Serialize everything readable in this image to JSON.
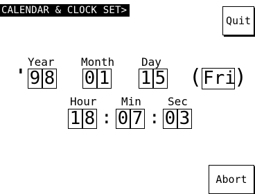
{
  "screen": {
    "title": "CALENDAR & CLOCK SET>"
  },
  "buttons": {
    "quit": "Quit",
    "abort": "Abort"
  },
  "date": {
    "labels": {
      "year": "Year",
      "month": "Month",
      "day": "Day"
    },
    "apostrophe": "'",
    "year": [
      "9",
      "8"
    ],
    "month": [
      "0",
      "1"
    ],
    "day": [
      "1",
      "5"
    ],
    "weekday": "Fri",
    "paren_open": "(",
    "paren_close": ")"
  },
  "time": {
    "labels": {
      "hour": "Hour",
      "min": "Min",
      "sec": "Sec"
    },
    "hour": [
      "1",
      "8"
    ],
    "min": [
      "0",
      "7"
    ],
    "sec": [
      "0",
      "3"
    ],
    "separator": ":"
  }
}
